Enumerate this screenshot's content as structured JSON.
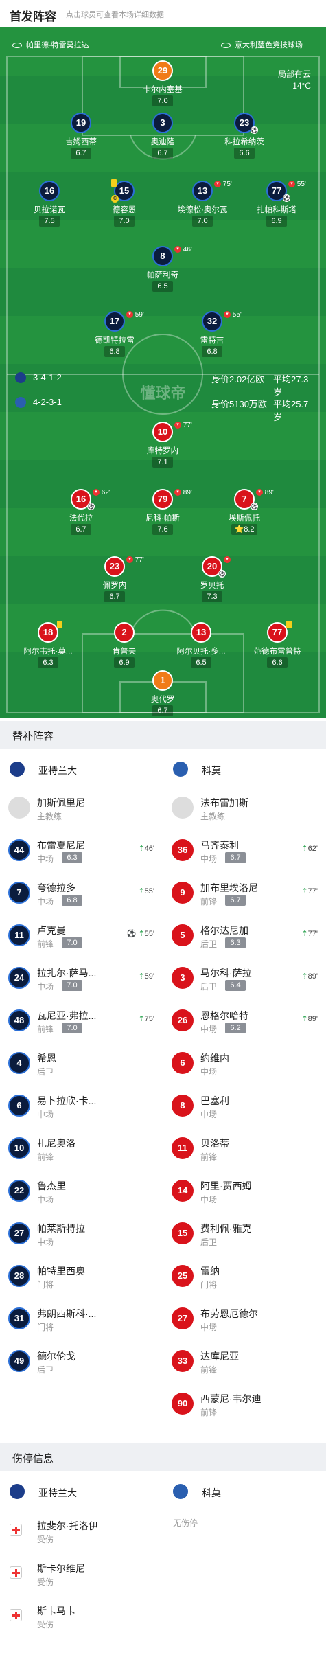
{
  "header": {
    "title": "首发阵容",
    "subtitle": "点击球员可查看本场详细数据"
  },
  "venue": {
    "home_stadium": "帕里德-特雷莫拉达",
    "away_stadium": "意大利蓝色竞技球场"
  },
  "weather": {
    "condition": "局部有云",
    "temp": "14°C"
  },
  "home_team": {
    "name": "亚特兰大",
    "formation": "3-4-1-2",
    "value": "身价2.02亿欧",
    "avg_age": "平均27.3岁",
    "color": "#2b6fd6"
  },
  "away_team": {
    "name": "科莫",
    "formation": "4-2-3-1",
    "value": "身价5130万欧",
    "avg_age": "平均25.7岁",
    "color": "#d9131b"
  },
  "watermark": "懂球帝",
  "home_lineup": [
    {
      "num": "29",
      "name": "卡尔内塞基",
      "rating": "7.0",
      "gk": true
    },
    {
      "num": "19",
      "name": "吉姆西蒂",
      "rating": "6.7"
    },
    {
      "num": "3",
      "name": "奥迪隆",
      "rating": "6.7"
    },
    {
      "num": "23",
      "name": "科拉希纳茨",
      "rating": "6.6",
      "ball": "⚽"
    },
    {
      "num": "16",
      "name": "贝拉诺瓦",
      "rating": "7.5"
    },
    {
      "num": "15",
      "name": "德容恩",
      "rating": "7.0",
      "card": true,
      "captain": "C"
    },
    {
      "num": "13",
      "name": "埃德松·奥尔瓦",
      "rating": "7.0",
      "sub": "75'"
    },
    {
      "num": "77",
      "name": "扎帕科斯塔",
      "rating": "6.9",
      "sub": "55'",
      "ball": "⚽"
    },
    {
      "num": "8",
      "name": "帕萨利奇",
      "rating": "6.5",
      "sub": "46'"
    },
    {
      "num": "17",
      "name": "德凯特拉雷",
      "rating": "6.8",
      "sub": "59'"
    },
    {
      "num": "32",
      "name": "雷特吉",
      "rating": "6.8",
      "sub": "55'"
    }
  ],
  "away_lineup": [
    {
      "num": "10",
      "name": "库特罗内",
      "rating": "7.1",
      "sub": "77'"
    },
    {
      "num": "16",
      "name": "法代拉",
      "rating": "6.7",
      "sub": "62'",
      "ball": "⚽"
    },
    {
      "num": "79",
      "name": "尼科·帕斯",
      "rating": "7.6",
      "sub": "89'"
    },
    {
      "num": "7",
      "name": "埃斯佩托",
      "rating": "8.2",
      "sub": "89'",
      "star": "⭐",
      "ball": "⚽"
    },
    {
      "num": "23",
      "name": "佩罗内",
      "rating": "6.7",
      "sub": "77'"
    },
    {
      "num": "20",
      "name": "罗贝托",
      "rating": "7.3",
      "sub": "",
      "ball": "⚽"
    },
    {
      "num": "18",
      "name": "阿尔韦托·莫...",
      "rating": "6.3",
      "card": true
    },
    {
      "num": "2",
      "name": "肯普夫",
      "rating": "6.9"
    },
    {
      "num": "13",
      "name": "阿尔贝托·多...",
      "rating": "6.5"
    },
    {
      "num": "77",
      "name": "范德布雷普特",
      "rating": "6.6",
      "card": true
    },
    {
      "num": "1",
      "name": "奥代罗",
      "rating": "6.7",
      "gk": true
    }
  ],
  "subs": {
    "title": "替补阵容",
    "home": [
      {
        "num": "",
        "name": "加斯佩里尼",
        "pos": "主教练",
        "coach": true
      },
      {
        "num": "44",
        "name": "布雷夏尼尼",
        "pos": "中场",
        "rating": "6.3",
        "time": "46'"
      },
      {
        "num": "7",
        "name": "夸德拉多",
        "pos": "中场",
        "rating": "6.8",
        "time": "55'"
      },
      {
        "num": "11",
        "name": "卢克曼",
        "pos": "前锋",
        "rating": "7.0",
        "time": "55'",
        "extra": "⚽"
      },
      {
        "num": "24",
        "name": "拉扎尔·萨马...",
        "pos": "中场",
        "rating": "7.0",
        "time": "59'"
      },
      {
        "num": "48",
        "name": "瓦尼亚·弗拉...",
        "pos": "前锋",
        "rating": "7.0",
        "time": "75'"
      },
      {
        "num": "4",
        "name": "希恩",
        "pos": "后卫"
      },
      {
        "num": "6",
        "name": "易卜拉欣·卡...",
        "pos": "中场"
      },
      {
        "num": "10",
        "name": "扎尼奥洛",
        "pos": "前锋"
      },
      {
        "num": "22",
        "name": "鲁杰里",
        "pos": "中场"
      },
      {
        "num": "27",
        "name": "帕莱斯特拉",
        "pos": "中场"
      },
      {
        "num": "28",
        "name": "帕特里西奥",
        "pos": "门将"
      },
      {
        "num": "31",
        "name": "弗朗西斯科·...",
        "pos": "门将"
      },
      {
        "num": "49",
        "name": "德尔伦戈",
        "pos": "后卫"
      }
    ],
    "away": [
      {
        "num": "",
        "name": "法布雷加斯",
        "pos": "主教练",
        "coach": true
      },
      {
        "num": "36",
        "name": "马齐泰利",
        "pos": "中场",
        "rating": "6.7",
        "time": "62'"
      },
      {
        "num": "9",
        "name": "加布里埃洛尼",
        "pos": "前锋",
        "rating": "6.7",
        "time": "77'"
      },
      {
        "num": "5",
        "name": "格尔达尼加",
        "pos": "后卫",
        "rating": "6.3",
        "time": "77'"
      },
      {
        "num": "3",
        "name": "马尔科·萨拉",
        "pos": "后卫",
        "rating": "6.4",
        "time": "89'"
      },
      {
        "num": "26",
        "name": "恩格尔哈特",
        "pos": "中场",
        "rating": "6.2",
        "time": "89'"
      },
      {
        "num": "6",
        "name": "约维内",
        "pos": "中场"
      },
      {
        "num": "8",
        "name": "巴塞利",
        "pos": "中场"
      },
      {
        "num": "11",
        "name": "贝洛蒂",
        "pos": "前锋"
      },
      {
        "num": "14",
        "name": "阿里·贾西姆",
        "pos": "中场"
      },
      {
        "num": "15",
        "name": "费利佩·雅克",
        "pos": "后卫"
      },
      {
        "num": "25",
        "name": "雷纳",
        "pos": "门将"
      },
      {
        "num": "27",
        "name": "布劳恩厄德尔",
        "pos": "中场"
      },
      {
        "num": "33",
        "name": "达库尼亚",
        "pos": "前锋"
      },
      {
        "num": "90",
        "name": "西蒙尼·韦尔迪",
        "pos": "前锋"
      }
    ]
  },
  "injuries": {
    "title": "伤停信息",
    "home": [
      {
        "name": "拉斐尔·托洛伊",
        "status": "受伤"
      },
      {
        "name": "斯卡尔维尼",
        "status": "受伤"
      },
      {
        "name": "斯卡马卡",
        "status": "受伤"
      }
    ],
    "away_empty": "无伤停"
  }
}
